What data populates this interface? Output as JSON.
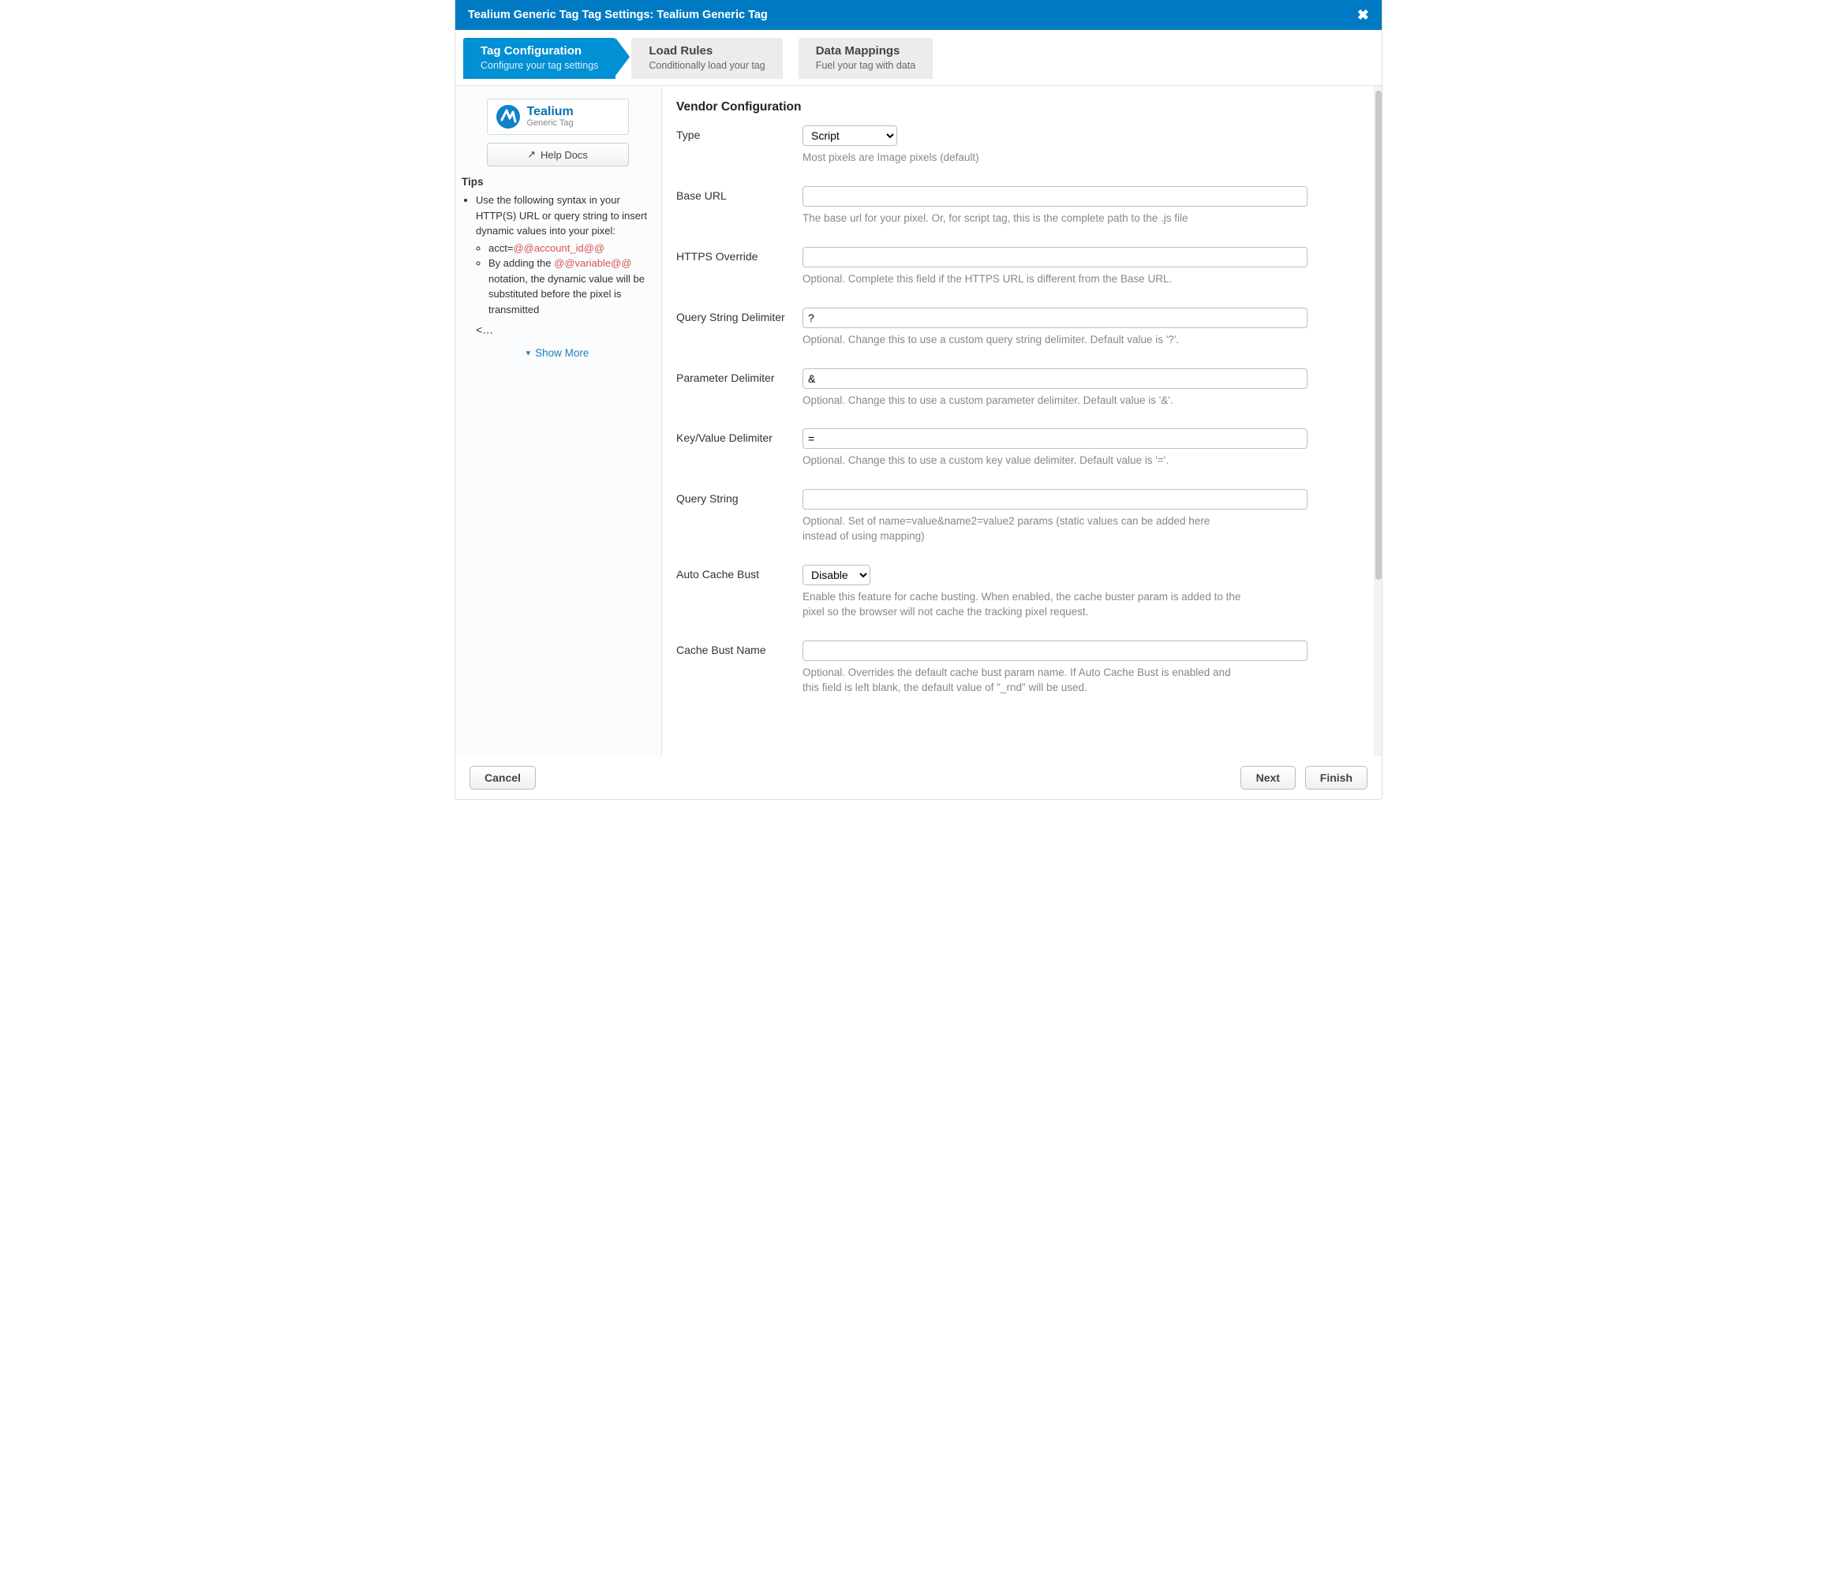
{
  "titlebar": {
    "text": "Tealium Generic Tag Tag Settings: Tealium Generic Tag"
  },
  "tabs": [
    {
      "title": "Tag Configuration",
      "sub": "Configure your tag settings",
      "active": true
    },
    {
      "title": "Load Rules",
      "sub": "Conditionally load your tag",
      "active": false
    },
    {
      "title": "Data Mappings",
      "sub": "Fuel your tag with data",
      "active": false
    }
  ],
  "sidebar": {
    "logo_word": "Tealium",
    "logo_sub": "Generic Tag",
    "help_label": "Help Docs",
    "tips_heading": "Tips",
    "tip_main": "Use the following syntax in your HTTP(S) URL or query string to insert dynamic values into your pixel:",
    "tip_ex_prefix": "acct=",
    "tip_ex_var": "@@account_id@@",
    "tip_sub_prefix": "By adding the ",
    "tip_sub_var": "@@variable@@",
    "tip_sub_suffix": " notation, the dynamic value will be substituted before the pixel is transmitted",
    "tip_trunc": "<…",
    "show_more": "Show More"
  },
  "section_heading": "Vendor Configuration",
  "fields": {
    "type": {
      "label": "Type",
      "value": "Script",
      "hint": "Most pixels are Image pixels (default)"
    },
    "base_url": {
      "label": "Base URL",
      "value": "",
      "hint": "The base url for your pixel. Or, for script tag, this is the complete path to the .js file"
    },
    "https_override": {
      "label": "HTTPS Override",
      "value": "",
      "hint": "Optional. Complete this field if the HTTPS URL is different from the Base URL."
    },
    "qs_delim": {
      "label": "Query String Delimiter",
      "value": "?",
      "hint": "Optional. Change this to use a custom query string delimiter. Default value is '?'."
    },
    "param_delim": {
      "label": "Parameter Delimiter",
      "value": "&",
      "hint": "Optional. Change this to use a custom parameter delimiter. Default value is '&'."
    },
    "kv_delim": {
      "label": "Key/Value Delimiter",
      "value": "=",
      "hint": "Optional. Change this to use a custom key value delimiter. Default value is '='."
    },
    "query_string": {
      "label": "Query String",
      "value": "",
      "hint": "Optional. Set of name=value&name2=value2 params (static values can be added here instead of using mapping)"
    },
    "auto_cache_bust": {
      "label": "Auto Cache Bust",
      "value": "Disable",
      "hint": "Enable this feature for cache busting. When enabled, the cache buster param is added to the pixel so the browser will not cache the tracking pixel request."
    },
    "cache_bust_name": {
      "label": "Cache Bust Name",
      "value": "",
      "hint": "Optional. Overrides the default cache bust param name. If Auto Cache Bust is enabled and this field is left blank, the default value of \"_rnd\" will be used."
    }
  },
  "footer": {
    "cancel": "Cancel",
    "next": "Next",
    "finish": "Finish"
  }
}
